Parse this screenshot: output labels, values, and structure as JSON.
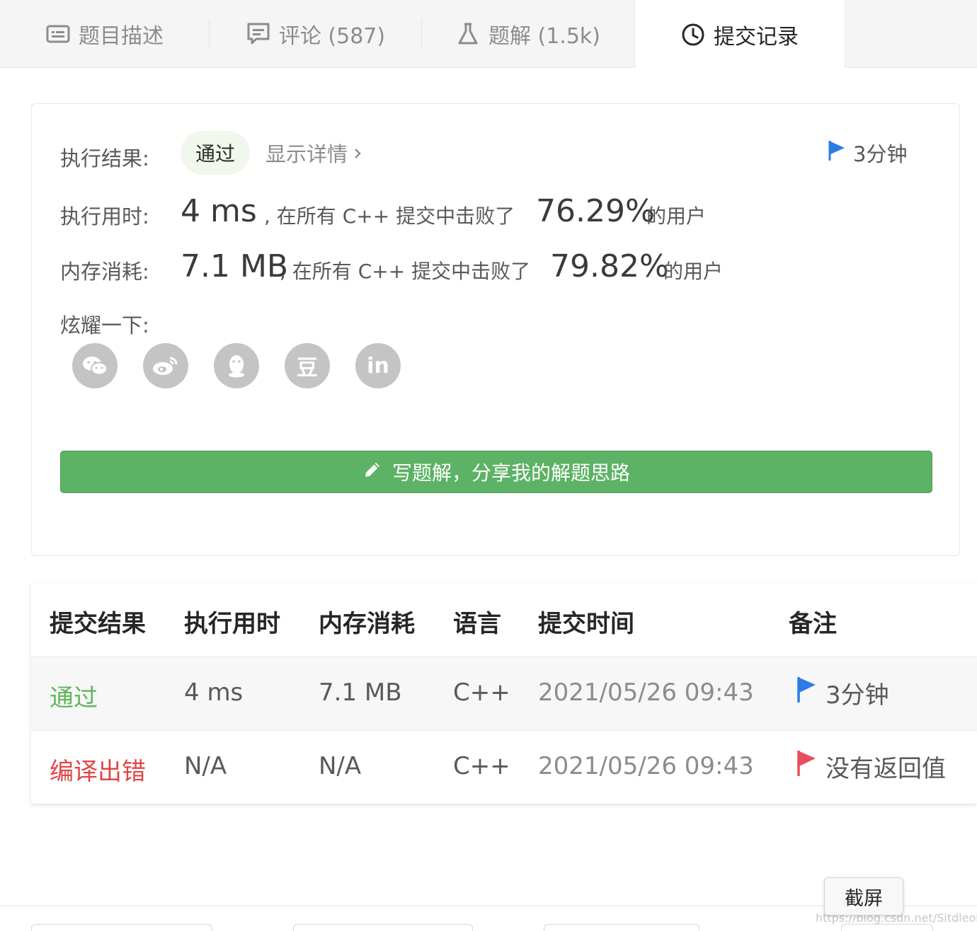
{
  "tabs": [
    {
      "label": "题目描述",
      "icon": "description-icon"
    },
    {
      "label": "评论 (587)",
      "icon": "comment-icon"
    },
    {
      "label": "题解 (1.5k)",
      "icon": "flask-icon"
    },
    {
      "label": "提交记录",
      "icon": "clock-icon",
      "active": true
    }
  ],
  "result": {
    "status_label": "执行结果:",
    "status": "通过",
    "detail_link": "显示详情",
    "elapsed": "3分钟",
    "runtime_label": "执行用时:",
    "runtime_value": "4 ms",
    "beat_text": ", 在所有 C++ 提交中击败了",
    "runtime_percent": "76.29%",
    "users_text": "的用户",
    "memory_label": "内存消耗:",
    "memory_value": "7.1 MB",
    "memory_percent": "79.82%",
    "share_label": "炫耀一下:",
    "share_icons": [
      "wechat-icon",
      "weibo-icon",
      "qq-icon",
      "douban-icon",
      "linkedin-icon"
    ],
    "douban_glyph": "豆",
    "linkedin_glyph": "in",
    "write_button": "写题解，分享我的解题思路"
  },
  "table": {
    "headers": [
      "提交结果",
      "执行用时",
      "内存消耗",
      "语言",
      "提交时间",
      "备注"
    ],
    "rows": [
      {
        "result": "通过",
        "runtime": "4 ms",
        "memory": "7.1 MB",
        "lang": "C++",
        "time": "2021/05/26 09:43",
        "note": "3分钟",
        "flag_color": "#2d7be5"
      },
      {
        "result": "编译出错",
        "runtime": "N/A",
        "memory": "N/A",
        "lang": "C++",
        "time": "2021/05/26 09:43",
        "note": "没有返回值",
        "flag_color": "#e84d5b"
      }
    ]
  },
  "tooltip": "截屏",
  "watermark": "https://blog.csdn.net/Sitdleohao",
  "colors": {
    "accent_green": "#5cb265",
    "pass_green": "#5cb85c",
    "error_red": "#e04646",
    "flag_blue": "#2d7be5",
    "flag_red": "#e84d5b"
  }
}
